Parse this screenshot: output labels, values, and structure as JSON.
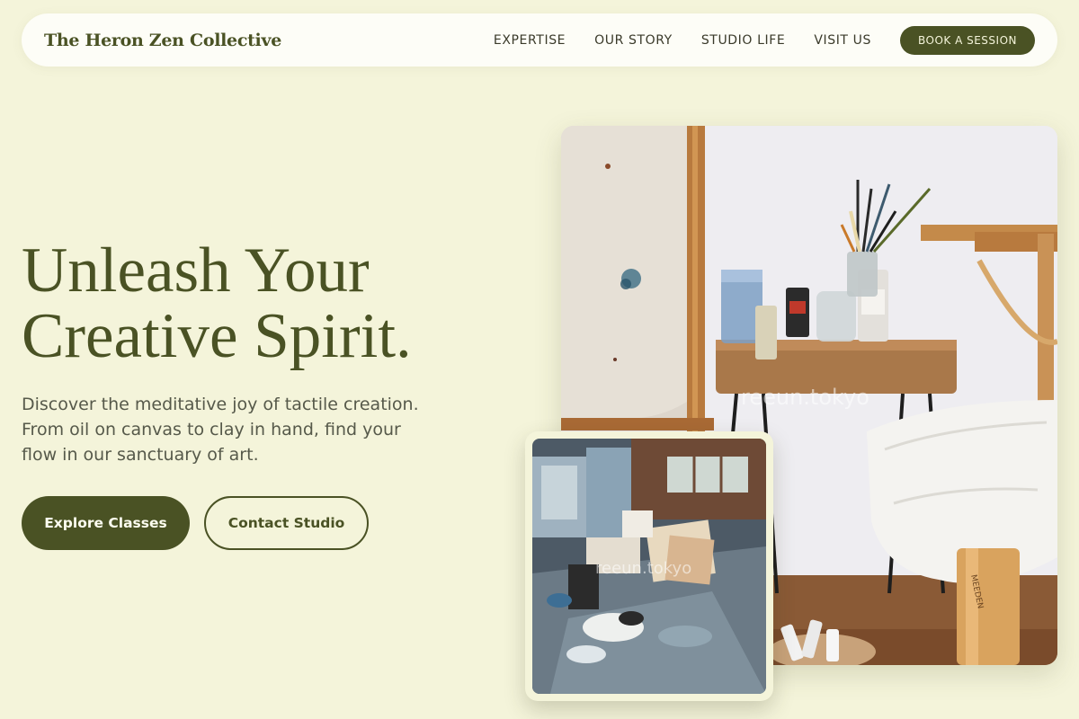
{
  "header": {
    "brand": "The Heron Zen Collective",
    "nav": [
      "EXPERTISE",
      "OUR STORY",
      "STUDIO LIFE",
      "VISIT US"
    ],
    "cta": "BOOK A SESSION"
  },
  "hero": {
    "title_line1": "Unleash Your",
    "title_line2": "Creative Spirit.",
    "subtitle": "Discover the meditative joy of tactile creation. From oil on canvas to clay in hand, find your flow in our sanctuary of art.",
    "primary_button": "Explore Classes",
    "secondary_button": "Contact Studio"
  },
  "images": {
    "main_watermark": "reeun.tokyo",
    "inset_watermark": "reeun.tokyo",
    "stool_brand": "MEEDEN"
  },
  "colors": {
    "background": "#f4f4da",
    "accent": "#4a5224",
    "nav_bg": "#fdfdf7"
  }
}
